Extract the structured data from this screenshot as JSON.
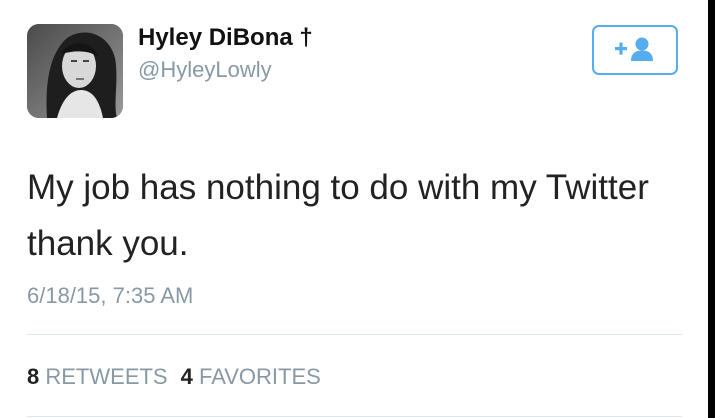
{
  "author": {
    "display_name": "Hyley DiBona †",
    "handle": "@HyleyLowly",
    "avatar_icon": "profile-photo"
  },
  "follow_button": {
    "icon": "add-user-icon",
    "color": "#55acee"
  },
  "tweet": {
    "text": "My job has nothing to do with my Twitter thank you.",
    "timestamp": "6/18/15, 7:35 AM"
  },
  "stats": {
    "retweets_count": "8",
    "retweets_label": "RETWEETS",
    "favorites_count": "4",
    "favorites_label": "FAVORITES"
  },
  "colors": {
    "text_primary": "#222222",
    "text_secondary": "#8899a6",
    "accent": "#55acee",
    "divider": "#e1e8ed"
  }
}
